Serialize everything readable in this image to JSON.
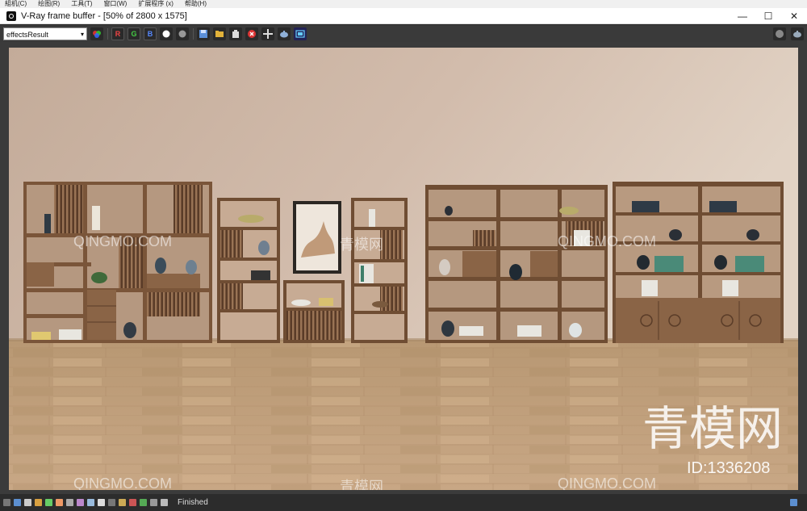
{
  "app_menu": {
    "items": [
      "組机(C)",
      "绘图(R)",
      "工具(T)",
      "窗口(W)",
      "扩展程序 (x)",
      "帮助(H)"
    ]
  },
  "window": {
    "title": "V-Ray frame buffer - [50% of 2800 x 1575]",
    "controls": {
      "minimize": "—",
      "maximize": "☐",
      "close": "✕"
    }
  },
  "toolbar": {
    "channel_value": "effectsResult",
    "channel_buttons": {
      "r": "R",
      "g": "G",
      "b": "B"
    }
  },
  "status": {
    "text": "Finished"
  },
  "watermark": {
    "brand_cn": "青模网",
    "brand_en": "QINGMO.COM",
    "id_text": "ID:1336208"
  },
  "colors": {
    "wall": "#c8b1a0",
    "floor": "#c9a782",
    "wood_dark": "#6a4a33",
    "wood_mid": "#8a6446"
  }
}
